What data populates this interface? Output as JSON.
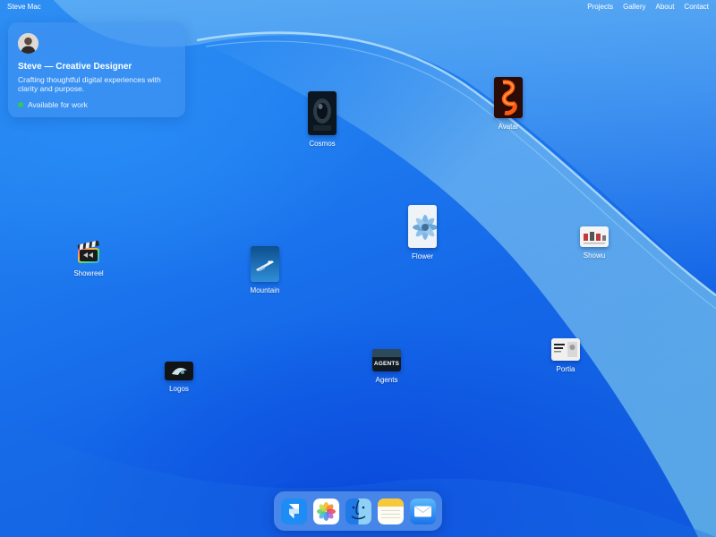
{
  "topbar": {
    "brand": "Steve Mac",
    "nav": [
      "Projects",
      "Gallery",
      "About",
      "Contact"
    ]
  },
  "profile": {
    "name": "Steve — Creative Designer",
    "tagline": "Crafting thoughtful digital experiences with clarity and purpose.",
    "status": "Available for work",
    "status_color": "#34c759"
  },
  "desktop_icons": [
    {
      "label": "Cosmos",
      "icon": "cosmos-thumbnail"
    },
    {
      "label": "Avatar",
      "icon": "avatar-thumbnail"
    },
    {
      "label": "Flower",
      "icon": "flower-thumbnail"
    },
    {
      "label": "Showu",
      "icon": "showu-thumbnail"
    },
    {
      "label": "Showreel",
      "icon": "final-cut-clapper-icon"
    },
    {
      "label": "Mountain",
      "icon": "mountain-thumbnail"
    },
    {
      "label": "Portia",
      "icon": "portia-thumbnail"
    },
    {
      "label": "Agents",
      "icon": "agents-thumbnail",
      "thumb_text": "AGENTS"
    },
    {
      "label": "Logos",
      "icon": "logos-thumbnail"
    }
  ],
  "dock": [
    {
      "app": "Framer",
      "icon": "framer-icon"
    },
    {
      "app": "Photos",
      "icon": "photos-icon"
    },
    {
      "app": "Finder",
      "icon": "finder-icon"
    },
    {
      "app": "Notes",
      "icon": "notes-icon"
    },
    {
      "app": "Mail",
      "icon": "mail-icon"
    }
  ],
  "colors": {
    "wallpaper_blue": "#1f7cef",
    "accent_green": "#34c759"
  }
}
